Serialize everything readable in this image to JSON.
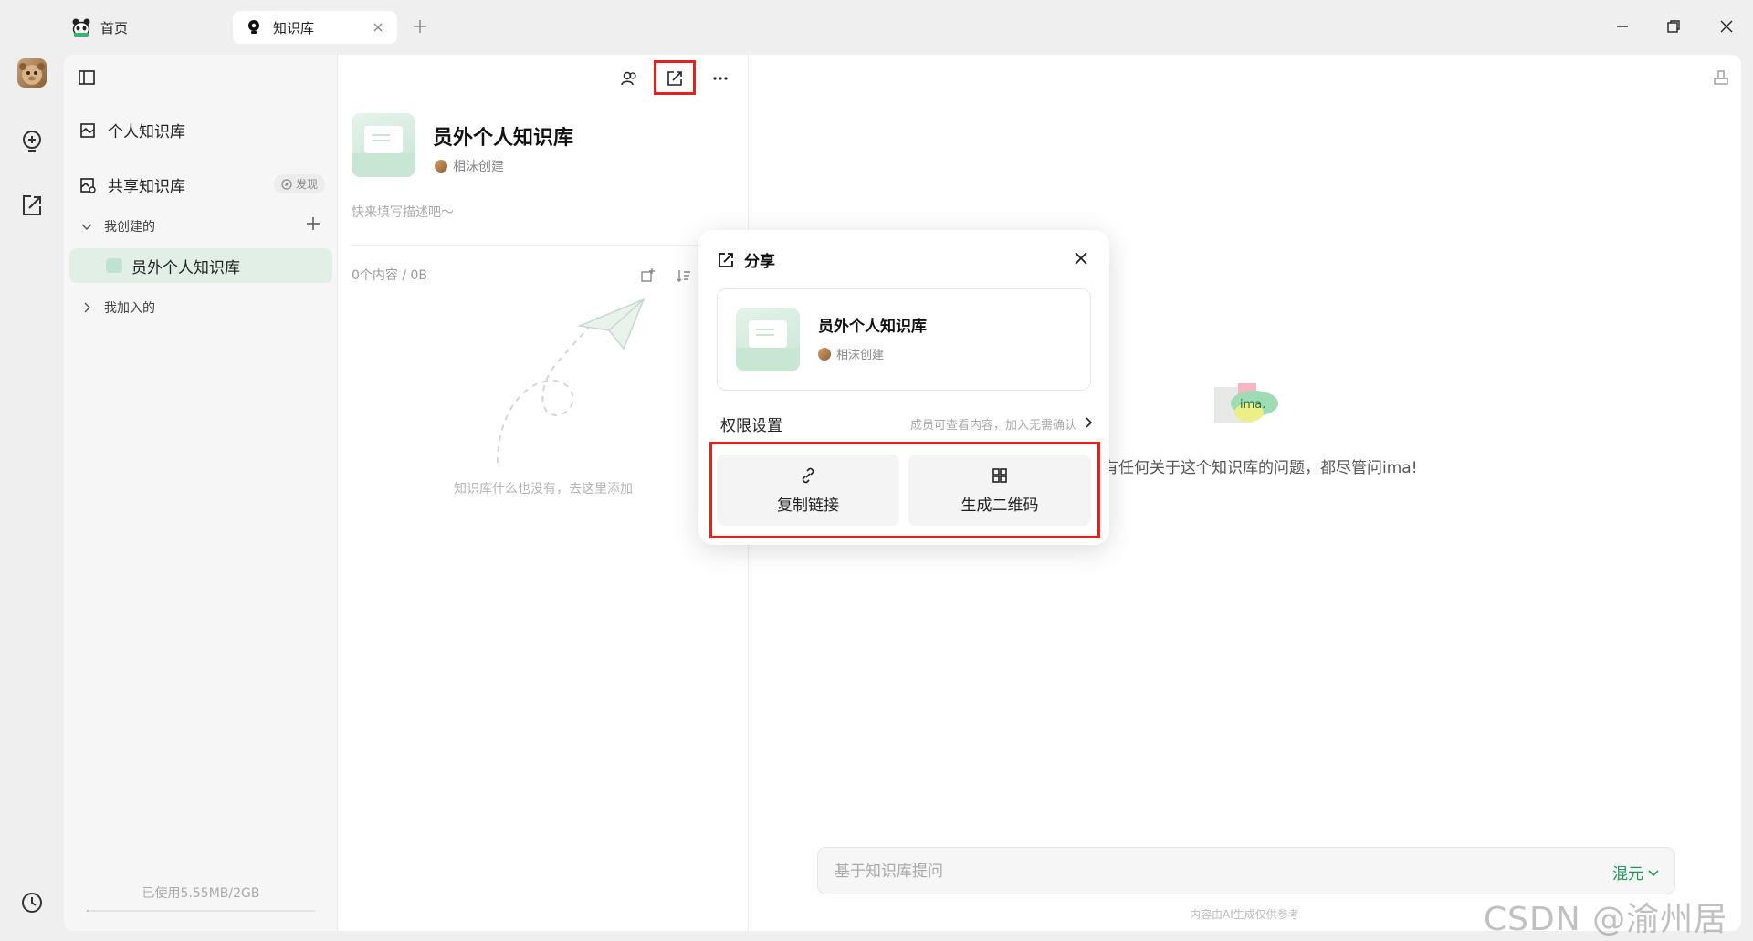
{
  "tabs": [
    {
      "label": "首页"
    },
    {
      "label": "知识库"
    }
  ],
  "sidebar": {
    "personal_label": "个人知识库",
    "shared_label": "共享知识库",
    "discover_label": "发现",
    "created_label": "我创建的",
    "selected_item": "员外个人知识库",
    "joined_label": "我加入的",
    "usage_label": "已使用5.55MB/2GB",
    "usage_fraction": 0.0027
  },
  "kb": {
    "title": "员外个人知识库",
    "creator": "相沫创建",
    "description_placeholder": "快来填写描述吧～",
    "stats": "0个内容 / 0B",
    "empty_text": "知识库什么也没有，去这里添加"
  },
  "chat": {
    "logo_text": "ima.",
    "prompt_text": "有任何关于这个知识库的问题，都尽管问ima!",
    "input_placeholder": "基于知识库提问",
    "model_label": "混元",
    "disclaimer": "内容由AI生成仅供参考"
  },
  "share_popup": {
    "title": "分享",
    "kb_title": "员外个人知识库",
    "kb_creator": "相沫创建",
    "perm_label": "权限设置",
    "perm_hint": "成员可查看内容，加入无需确认",
    "copy_link": "复制链接",
    "qr_code": "生成二维码"
  },
  "watermark": "CSDN @渝州居士",
  "colors": {
    "accent_green": "#1f9a5a",
    "highlight_red": "#e4211b",
    "selected_bg": "#e2efe7"
  }
}
